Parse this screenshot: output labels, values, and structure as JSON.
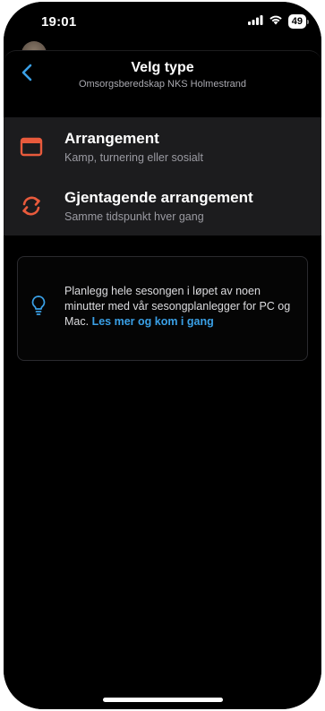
{
  "status_bar": {
    "time": "19:01",
    "battery": "49",
    "icons": [
      "cellular-signal-icon",
      "wifi-icon",
      "battery-icon"
    ]
  },
  "header": {
    "title": "Velg type",
    "subtitle": "Omsorgsberedskap NKS Holmestrand",
    "back_icon": "chevron-left-icon"
  },
  "options": [
    {
      "title": "Arrangement",
      "description": "Kamp, turnering eller sosialt",
      "icon": "calendar-icon",
      "icon_color": "#e85a3c"
    },
    {
      "title": "Gjentagende arrangement",
      "description": "Samme tidspunkt hver gang",
      "icon": "repeat-icon",
      "icon_color": "#e85a3c"
    }
  ],
  "tip": {
    "icon": "lightbulb-icon",
    "text": "Planlegg hele sesongen i løpet av noen minutter med vår sesongplanlegger for PC og Mac.",
    "link_text": "Les mer og kom i gang"
  },
  "colors": {
    "accent": "#3aa0e6",
    "icon_orange": "#e85a3c",
    "background": "#000000",
    "list_background": "#1c1c1e"
  }
}
